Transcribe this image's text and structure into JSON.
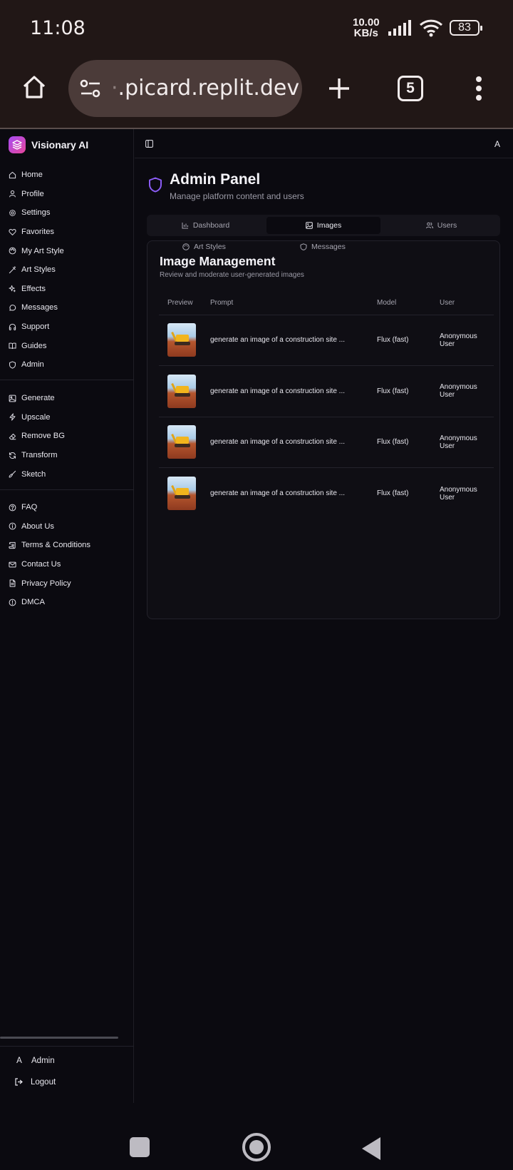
{
  "status": {
    "time": "11:08",
    "net_speed_value": "10.00",
    "net_speed_unit": "KB/s",
    "battery": "83"
  },
  "browser": {
    "url_prefix": "·",
    "url": ".picard.replit.dev",
    "tab_count": "5"
  },
  "sidebar": {
    "brand": "Visionary AI",
    "main_items": [
      {
        "label": "Home",
        "icon": "home-icon"
      },
      {
        "label": "Profile",
        "icon": "user-icon"
      },
      {
        "label": "Settings",
        "icon": "gear-icon"
      },
      {
        "label": "Favorites",
        "icon": "heart-icon"
      },
      {
        "label": "My Art Style",
        "icon": "palette-icon"
      },
      {
        "label": "Art Styles",
        "icon": "wand-icon"
      },
      {
        "label": "Effects",
        "icon": "sparkles-icon"
      },
      {
        "label": "Messages",
        "icon": "message-icon"
      },
      {
        "label": "Support",
        "icon": "headphones-icon"
      },
      {
        "label": "Guides",
        "icon": "book-icon"
      },
      {
        "label": "Admin",
        "icon": "shield-icon"
      }
    ],
    "tool_items": [
      {
        "label": "Generate",
        "icon": "image-icon"
      },
      {
        "label": "Upscale",
        "icon": "zap-icon"
      },
      {
        "label": "Remove BG",
        "icon": "eraser-icon"
      },
      {
        "label": "Transform",
        "icon": "refresh-icon"
      },
      {
        "label": "Sketch",
        "icon": "brush-icon"
      }
    ],
    "info_items": [
      {
        "label": "FAQ",
        "icon": "help-icon"
      },
      {
        "label": "About Us",
        "icon": "info-icon"
      },
      {
        "label": "Terms & Conditions",
        "icon": "scroll-icon"
      },
      {
        "label": "Contact Us",
        "icon": "mail-icon"
      },
      {
        "label": "Privacy Policy",
        "icon": "file-icon"
      },
      {
        "label": "DMCA",
        "icon": "alert-icon"
      }
    ],
    "footer": {
      "avatar_letter": "A",
      "user": "Admin",
      "logout": "Logout"
    }
  },
  "topbar": {
    "avatar_letter": "A"
  },
  "panel": {
    "title": "Admin Panel",
    "subtitle": "Manage platform content and users"
  },
  "tabs": [
    {
      "label": "Dashboard",
      "icon": "bar-chart-icon",
      "active": false
    },
    {
      "label": "Images",
      "icon": "image-icon",
      "active": true
    },
    {
      "label": "Users",
      "icon": "users-icon",
      "active": false
    }
  ],
  "subtabs": [
    {
      "label": "Art Styles",
      "icon": "palette-icon"
    },
    {
      "label": "Messages",
      "icon": "shield-icon"
    }
  ],
  "card": {
    "title": "Image Management",
    "subtitle": "Review and moderate user-generated images",
    "columns": [
      "Preview",
      "Prompt",
      "Model",
      "User"
    ],
    "rows": [
      {
        "prompt": "generate an image of a construction site ...",
        "model": "Flux (fast)",
        "user": "Anonymous User"
      },
      {
        "prompt": "generate an image of a construction site ...",
        "model": "Flux (fast)",
        "user": "Anonymous User"
      },
      {
        "prompt": "generate an image of a construction site ...",
        "model": "Flux (fast)",
        "user": "Anonymous User"
      },
      {
        "prompt": "generate an image of a construction site ...",
        "model": "Flux (fast)",
        "user": "Anonymous User"
      }
    ]
  },
  "colors": {
    "accent": "#8b5cf6",
    "brand_gradient_start": "#a64cf5",
    "brand_gradient_end": "#e8469a",
    "background": "#0b0a10"
  }
}
